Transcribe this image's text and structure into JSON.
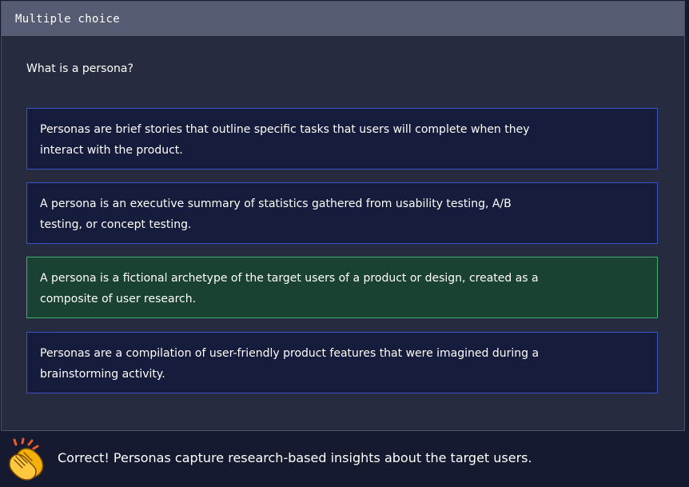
{
  "card": {
    "title": "Multiple choice",
    "question": "What is a persona?"
  },
  "options": [
    {
      "text": "Personas are brief stories that outline specific tasks that users will complete when they interact with the product.",
      "state": "default"
    },
    {
      "text": "A persona is an executive summary of statistics gathered from usability testing, A/B testing, or concept testing.",
      "state": "default"
    },
    {
      "text": "A persona is a fictional archetype of the target users of a product or design, created as a composite of user research.",
      "state": "correct"
    },
    {
      "text": "Personas are a compilation of user-friendly product features that were imagined during a brainstorming activity.",
      "state": "default"
    }
  ],
  "feedback": {
    "icon": "clapping-hands-icon",
    "text": "Correct! Personas capture research-based insights about the target users."
  },
  "colors": {
    "page_bg": "#161a30",
    "card_bg": "#262b3f",
    "header_bg": "#565c73",
    "option_bg": "#161c3c",
    "option_border": "#3a52c4",
    "correct_bg": "#1a4232",
    "correct_border": "#3fae6d"
  }
}
